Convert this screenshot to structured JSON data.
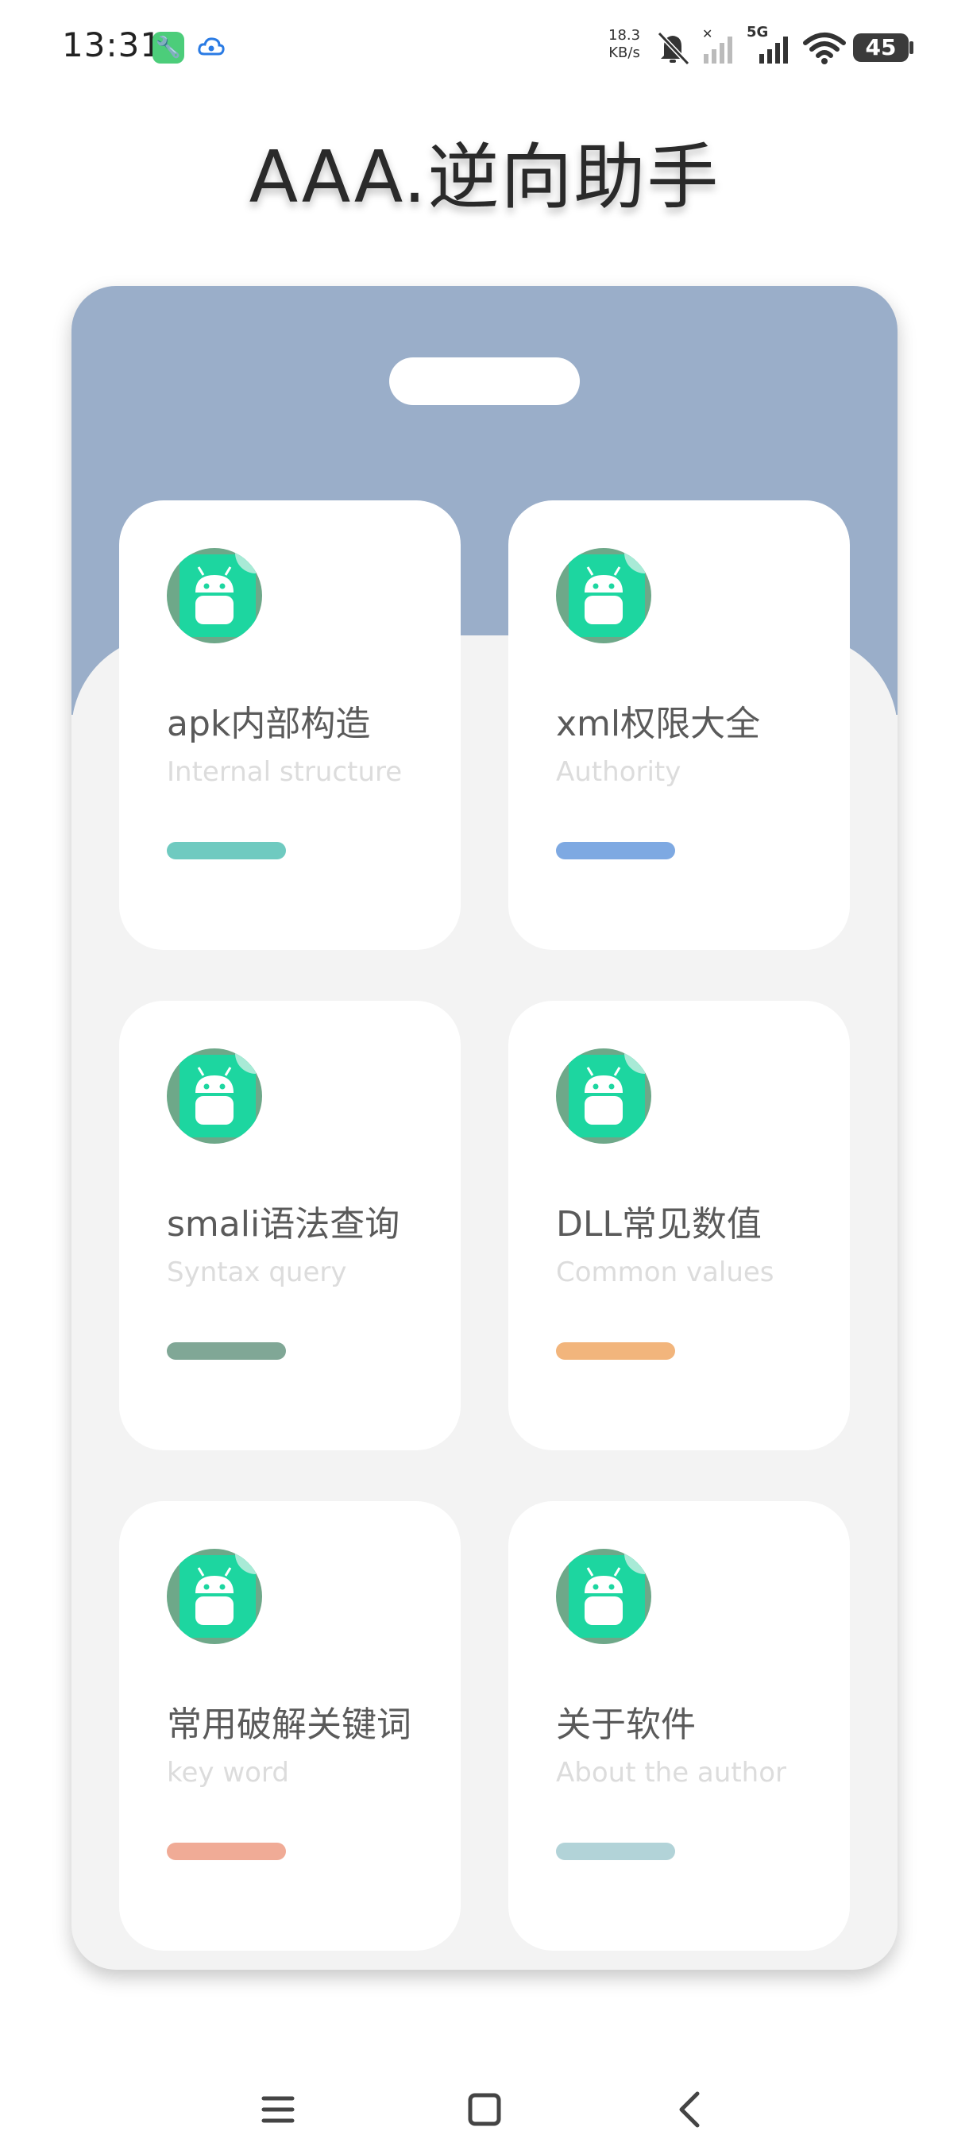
{
  "status_bar": {
    "time": "13:31",
    "net_speed_value": "18.3",
    "net_speed_unit": "KB/s",
    "network_label": "5G",
    "battery": "45",
    "icons": [
      "wrench-app-icon",
      "cloud-app-icon",
      "mute-icon",
      "no-signal-icon",
      "signal-icon",
      "wifi-icon",
      "battery-icon"
    ]
  },
  "header": {
    "title": "AAA.逆向助手"
  },
  "cards": [
    {
      "title": "apk内部构造",
      "subtitle": "Internal structure",
      "bar_color": "#6fcac0",
      "icon": "android-icon"
    },
    {
      "title": "xml权限大全",
      "subtitle": "Authority",
      "bar_color": "#7ea9e2",
      "icon": "android-icon"
    },
    {
      "title": "smali语法查询",
      "subtitle": "Syntax query",
      "bar_color": "#80a796",
      "icon": "android-icon"
    },
    {
      "title": "DLL常见数值",
      "subtitle": "Common values",
      "bar_color": "#f2b57c",
      "icon": "android-icon"
    },
    {
      "title": "常用破解关键词",
      "subtitle": "key word",
      "bar_color": "#f0ab96",
      "icon": "android-icon"
    },
    {
      "title": "关于软件",
      "subtitle": "About the author",
      "bar_color": "#b2d3d8",
      "icon": "android-icon"
    }
  ],
  "colors": {
    "panel_top": "#9aaec9",
    "panel_body": "#f3f3f3",
    "avatar_ring": "#6ea889",
    "avatar_fill": "#1dd6a0"
  },
  "nav": {
    "icons": [
      "menu-icon",
      "home-icon",
      "back-icon"
    ]
  }
}
